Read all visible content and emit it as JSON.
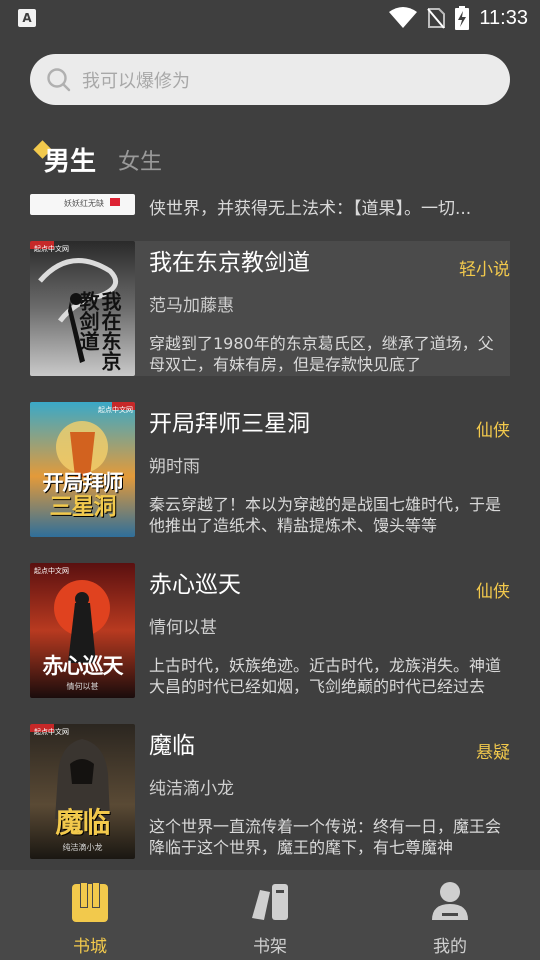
{
  "status_bar": {
    "time": "11:33",
    "notification_icon": "A"
  },
  "search": {
    "placeholder": "我可以爆修为"
  },
  "gender_tabs": {
    "active": "男生",
    "inactive": "女生"
  },
  "partial_book": {
    "cover_text": "妖妖红无缺",
    "description": "侠世界，并获得无上法术：【道果】。一切..."
  },
  "books": [
    {
      "title": "我在东京教剑道",
      "genre": "轻小说",
      "author": "范马加藤惠",
      "description": "穿越到了1980年的东京葛氏区，继承了道场，父母双亡，有妹有房，但是存款快见底了",
      "cover_title": "我在东京教剑道",
      "cover_publisher": "起点中文网",
      "cover_author": "范马加藤惠"
    },
    {
      "title": "开局拜师三星洞",
      "genre": "仙侠",
      "author": "朔时雨",
      "description": "秦云穿越了！本以为穿越的是战国七雄时代，于是他推出了造纸术、精盐提炼术、馒头等等",
      "cover_title": "开局拜师",
      "cover_title2": "三星洞",
      "cover_publisher": "起点中文网",
      "cover_author": "朔时雨"
    },
    {
      "title": "赤心巡天",
      "genre": "仙侠",
      "author": "情何以甚",
      "description": "上古时代，妖族绝迹。近古时代，龙族消失。神道大昌的时代已经如烟，飞剑绝巅的时代已经过去",
      "cover_title": "赤心巡天",
      "cover_publisher": "起点中文网",
      "cover_author": "情何以甚"
    },
    {
      "title": "魔临",
      "genre": "悬疑",
      "author": "纯洁滴小龙",
      "description": "这个世界一直流传着一个传说：终有一日，魔王会降临于这个世界，魔王的麾下，有七尊魔神",
      "cover_title": "魔临",
      "cover_publisher": "起点中文网",
      "cover_author": "纯洁滴小龙"
    }
  ],
  "bottom_nav": {
    "items": [
      {
        "label": "书城",
        "icon": "bookstore-icon",
        "active": true
      },
      {
        "label": "书架",
        "icon": "bookshelf-icon",
        "active": false
      },
      {
        "label": "我的",
        "icon": "profile-icon",
        "active": false
      }
    ]
  },
  "colors": {
    "background": "#3f3f3f",
    "accent": "#f2c94c",
    "search_bg": "#ebebeb",
    "nav_bg": "#484848"
  }
}
